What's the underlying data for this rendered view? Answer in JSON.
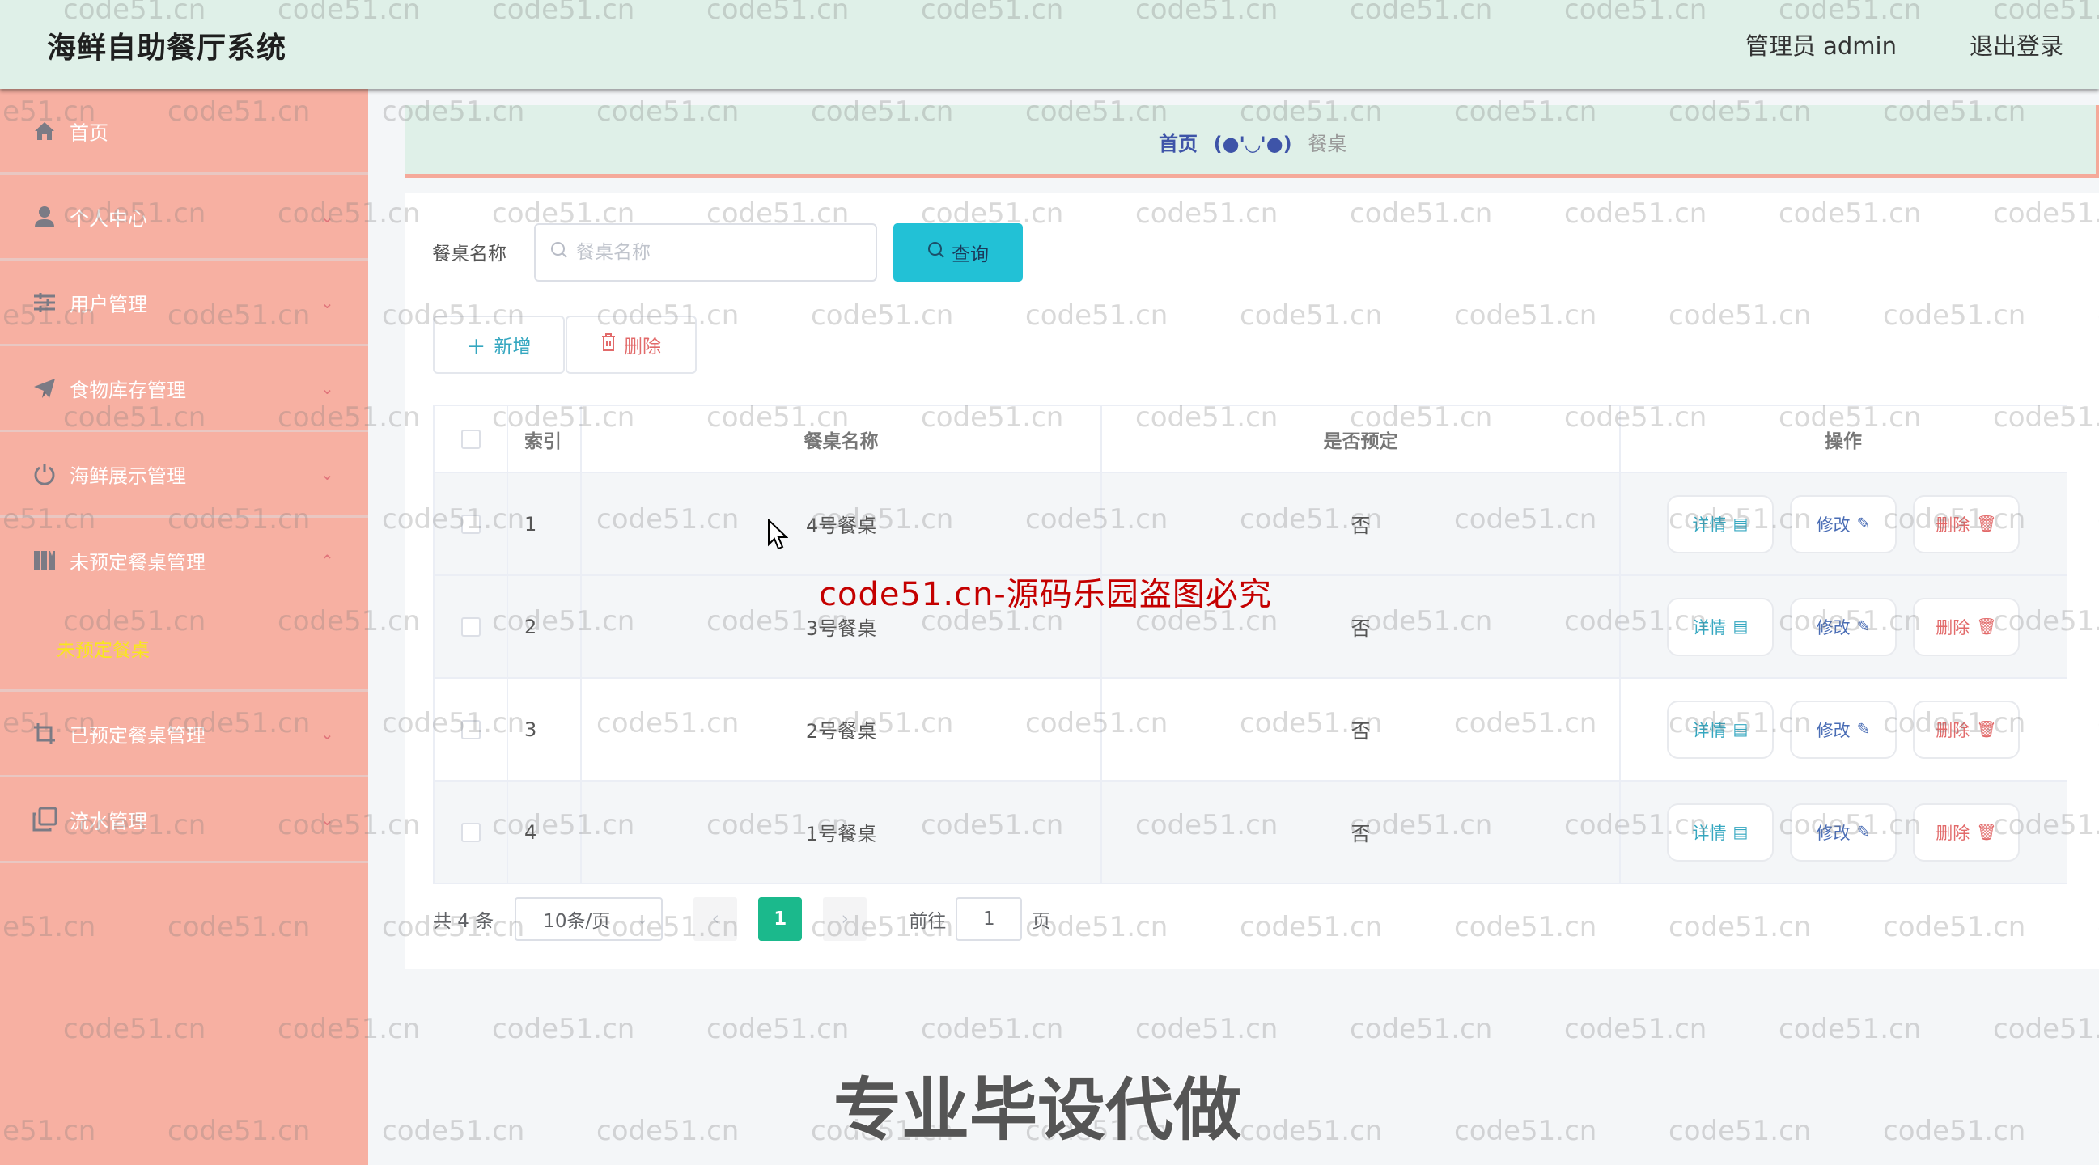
{
  "header": {
    "title": "海鲜自助餐厅系统",
    "user_label": "管理员 admin",
    "logout_label": "退出登录"
  },
  "sidebar": {
    "items": [
      {
        "label": "首页",
        "icon": "home-icon",
        "has_children": false
      },
      {
        "label": "个人中心",
        "icon": "user-icon",
        "has_children": true
      },
      {
        "label": "用户管理",
        "icon": "sliders-icon",
        "has_children": true
      },
      {
        "label": "食物库存管理",
        "icon": "paper-plane-icon",
        "has_children": true
      },
      {
        "label": "海鲜展示管理",
        "icon": "power-icon",
        "has_children": true
      },
      {
        "label": "未预定餐桌管理",
        "icon": "book-icon",
        "has_children": true,
        "expanded": true,
        "children": [
          {
            "label": "未预定餐桌",
            "active": true
          }
        ]
      },
      {
        "label": "已预定餐桌管理",
        "icon": "crop-icon",
        "has_children": true
      },
      {
        "label": "流水管理",
        "icon": "copy-icon",
        "has_children": true
      }
    ]
  },
  "breadcrumb": {
    "home": "首页",
    "separator": "(●'◡'●)",
    "current": "餐桌"
  },
  "search": {
    "label": "餐桌名称",
    "placeholder": "餐桌名称",
    "value": "",
    "button_label": "查询"
  },
  "actions": {
    "add_label": "新增",
    "delete_label": "删除"
  },
  "table": {
    "columns": [
      "",
      "索引",
      "餐桌名称",
      "是否预定",
      "操作"
    ],
    "rows": [
      {
        "index": "1",
        "name": "4号餐桌",
        "booked": "否"
      },
      {
        "index": "2",
        "name": "3号餐桌",
        "booked": "否"
      },
      {
        "index": "3",
        "name": "2号餐桌",
        "booked": "否"
      },
      {
        "index": "4",
        "name": "1号餐桌",
        "booked": "否"
      }
    ],
    "row_actions": {
      "detail": "详情",
      "edit": "修改",
      "delete": "删除"
    }
  },
  "pagination": {
    "total": "共 4 条",
    "page_size": "10条/页",
    "current_page": "1",
    "goto_label": "前往",
    "goto_value": "1",
    "page_suffix": "页"
  },
  "overlays": {
    "watermark": "code51.cn",
    "notice": "code51.cn-源码乐园盗图必究",
    "promo": "专业毕设代做"
  },
  "colors": {
    "topbar_bg": "#dff0e8",
    "sidebar_bg": "#f7b0a2",
    "submenu_active": "#f8e71c",
    "query_button": "#22c1d6",
    "page_active": "#1bb98c",
    "breadcrumb_home": "#3e54a8",
    "danger": "#e26a6a"
  }
}
